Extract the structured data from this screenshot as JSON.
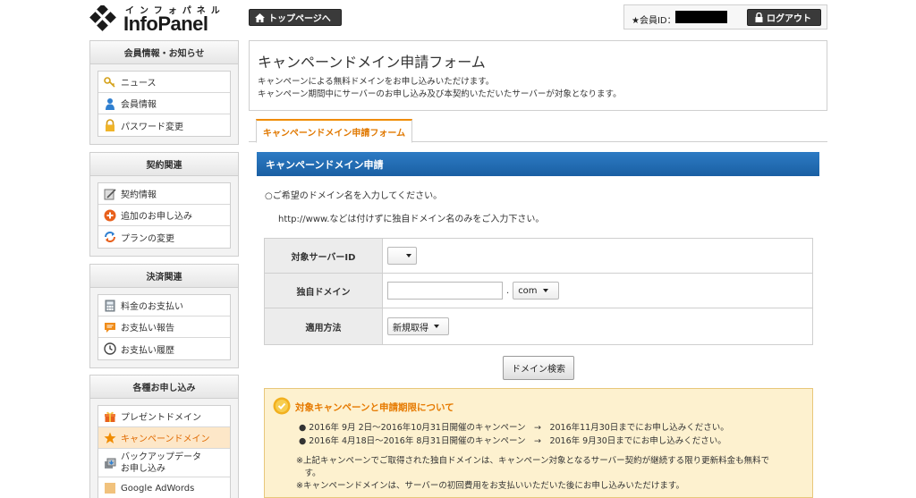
{
  "header": {
    "logo_kana": "インフォパネル",
    "logo_text": "InfoPanel",
    "top_page_label": "トップページへ",
    "member_label": "★会員ID：",
    "logout_label": "ログアウト"
  },
  "sidebar": [
    {
      "title": "会員情報・お知らせ",
      "items": [
        {
          "label": "ニュース",
          "icon": "key-icon"
        },
        {
          "label": "会員情報",
          "icon": "user-icon"
        },
        {
          "label": "パスワード変更",
          "icon": "lock-icon"
        }
      ]
    },
    {
      "title": "契約関連",
      "items": [
        {
          "label": "契約情報",
          "icon": "contract-icon"
        },
        {
          "label": "追加のお申し込み",
          "icon": "plus-circle-icon"
        },
        {
          "label": "プランの変更",
          "icon": "refresh-icon"
        }
      ]
    },
    {
      "title": "決済関連",
      "items": [
        {
          "label": "料金のお支払い",
          "icon": "calculator-icon"
        },
        {
          "label": "お支払い報告",
          "icon": "message-icon"
        },
        {
          "label": "お支払い履歴",
          "icon": "clock-icon"
        }
      ]
    },
    {
      "title": "各種お申し込み",
      "items": [
        {
          "label": "プレゼントドメイン",
          "icon": "gift-icon"
        },
        {
          "label": "キャンペーンドメイン",
          "icon": "star-icon",
          "active": true
        },
        {
          "label": "バックアップデータ",
          "label2": "お申し込み",
          "icon": "backup-icon"
        },
        {
          "label": "Google AdWords",
          "icon": "adwords-icon"
        }
      ]
    }
  ],
  "main": {
    "title": "キャンペーンドメイン申請フォーム",
    "desc1": "キャンペーンによる無料ドメインをお申し込みいただけます。",
    "desc2": "キャンペーン期間中にサーバーのお申し込み及び本契約いただいたサーバーが対象となります。",
    "tab_label": "キャンペーンドメイン申請フォーム",
    "section_title": "キャンペーンドメイン申請",
    "note1": "○ご希望のドメイン名を入力してください。",
    "note2": "http://www.などは付けずに独自ドメイン名のみをご入力下さい。",
    "form": {
      "server_id_label": "対象サーバーID",
      "server_id_value": "",
      "domain_label": "独自ドメイン",
      "domain_value": "",
      "domain_dot": ".",
      "tld_value": "com",
      "method_label": "適用方法",
      "method_value": "新規取得"
    },
    "search_button": "ドメイン検索",
    "info": {
      "title": "対象キャンペーンと申請期限について",
      "items": [
        "● 2016年 9月 2日～2016年10月31日開催のキャンペーン　→　2016年11月30日までにお申し込みください。",
        "● 2016年 4月18日～2016年 8月31日開催のキャンペーン　→　2016年 9月30日までにお申し込みください。"
      ],
      "notes": [
        "※上記キャンペーンでご取得された独自ドメインは、キャンペーン対象となるサーバー契約が継続する限り更新料金も無料で",
        "　す。",
        "※キャンペーンドメインは、サーバーの初回費用をお支払いいただいた後にお申し込みいただけます。"
      ]
    }
  },
  "colors": {
    "accent_orange": "#e67a00",
    "section_blue": "#1a5fa3",
    "info_bg": "#fdf1cf"
  }
}
